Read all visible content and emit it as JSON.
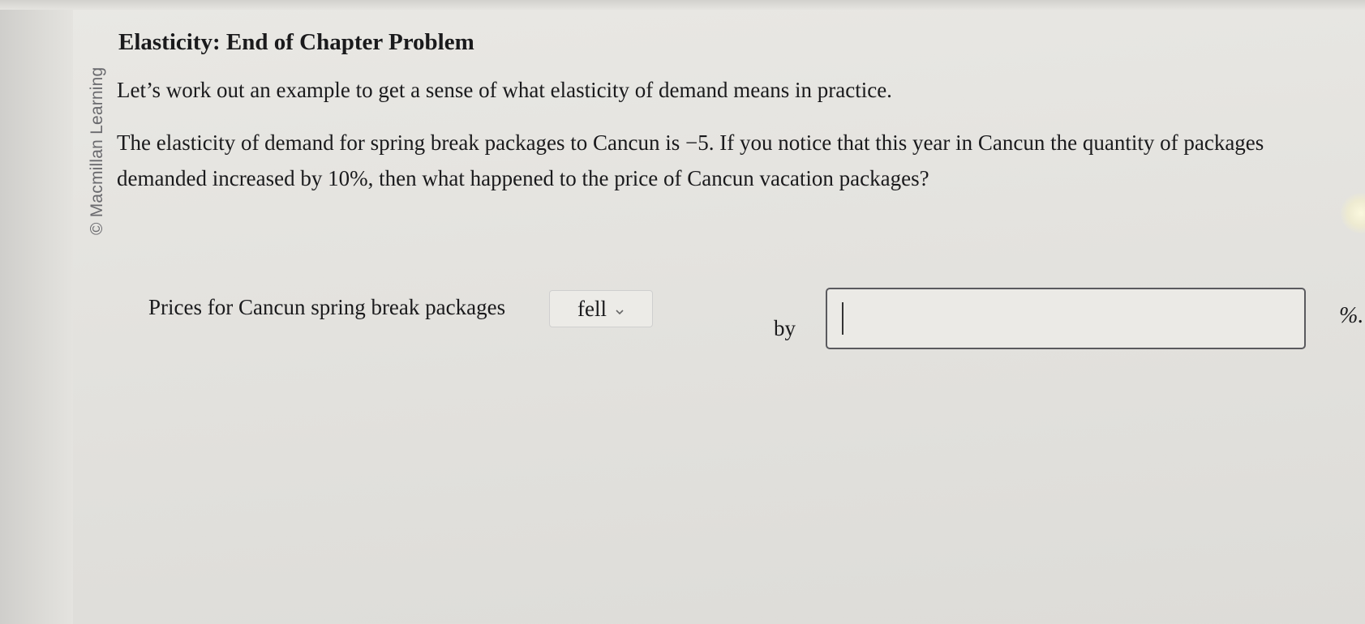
{
  "watermark": "© Macmillan Learning",
  "problem": {
    "title": "Elasticity: End of Chapter Problem",
    "intro": "Let’s work out an example to get a sense of what elasticity of demand means in practice.",
    "question": "The elasticity of demand for spring break packages to Cancun is −5. If you notice that this year in Cancun the quantity of packages demanded increased by 10%, then what happened to the price of Cancun vacation packages?"
  },
  "answer": {
    "prefix": "Prices for Cancun spring break packages",
    "direction_selected": "fell",
    "by_label": "by",
    "percent_value": "",
    "percent_suffix": "%."
  },
  "icons": {
    "dropdown": "chevron-down-icon"
  }
}
